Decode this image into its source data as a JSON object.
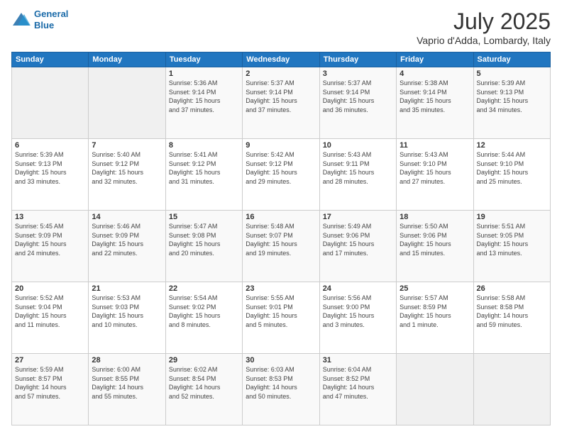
{
  "header": {
    "logo_line1": "General",
    "logo_line2": "Blue",
    "month_title": "July 2025",
    "location": "Vaprio d'Adda, Lombardy, Italy"
  },
  "days_of_week": [
    "Sunday",
    "Monday",
    "Tuesday",
    "Wednesday",
    "Thursday",
    "Friday",
    "Saturday"
  ],
  "weeks": [
    [
      {
        "day": "",
        "info": ""
      },
      {
        "day": "",
        "info": ""
      },
      {
        "day": "1",
        "info": "Sunrise: 5:36 AM\nSunset: 9:14 PM\nDaylight: 15 hours\nand 37 minutes."
      },
      {
        "day": "2",
        "info": "Sunrise: 5:37 AM\nSunset: 9:14 PM\nDaylight: 15 hours\nand 37 minutes."
      },
      {
        "day": "3",
        "info": "Sunrise: 5:37 AM\nSunset: 9:14 PM\nDaylight: 15 hours\nand 36 minutes."
      },
      {
        "day": "4",
        "info": "Sunrise: 5:38 AM\nSunset: 9:14 PM\nDaylight: 15 hours\nand 35 minutes."
      },
      {
        "day": "5",
        "info": "Sunrise: 5:39 AM\nSunset: 9:13 PM\nDaylight: 15 hours\nand 34 minutes."
      }
    ],
    [
      {
        "day": "6",
        "info": "Sunrise: 5:39 AM\nSunset: 9:13 PM\nDaylight: 15 hours\nand 33 minutes."
      },
      {
        "day": "7",
        "info": "Sunrise: 5:40 AM\nSunset: 9:12 PM\nDaylight: 15 hours\nand 32 minutes."
      },
      {
        "day": "8",
        "info": "Sunrise: 5:41 AM\nSunset: 9:12 PM\nDaylight: 15 hours\nand 31 minutes."
      },
      {
        "day": "9",
        "info": "Sunrise: 5:42 AM\nSunset: 9:12 PM\nDaylight: 15 hours\nand 29 minutes."
      },
      {
        "day": "10",
        "info": "Sunrise: 5:43 AM\nSunset: 9:11 PM\nDaylight: 15 hours\nand 28 minutes."
      },
      {
        "day": "11",
        "info": "Sunrise: 5:43 AM\nSunset: 9:10 PM\nDaylight: 15 hours\nand 27 minutes."
      },
      {
        "day": "12",
        "info": "Sunrise: 5:44 AM\nSunset: 9:10 PM\nDaylight: 15 hours\nand 25 minutes."
      }
    ],
    [
      {
        "day": "13",
        "info": "Sunrise: 5:45 AM\nSunset: 9:09 PM\nDaylight: 15 hours\nand 24 minutes."
      },
      {
        "day": "14",
        "info": "Sunrise: 5:46 AM\nSunset: 9:09 PM\nDaylight: 15 hours\nand 22 minutes."
      },
      {
        "day": "15",
        "info": "Sunrise: 5:47 AM\nSunset: 9:08 PM\nDaylight: 15 hours\nand 20 minutes."
      },
      {
        "day": "16",
        "info": "Sunrise: 5:48 AM\nSunset: 9:07 PM\nDaylight: 15 hours\nand 19 minutes."
      },
      {
        "day": "17",
        "info": "Sunrise: 5:49 AM\nSunset: 9:06 PM\nDaylight: 15 hours\nand 17 minutes."
      },
      {
        "day": "18",
        "info": "Sunrise: 5:50 AM\nSunset: 9:06 PM\nDaylight: 15 hours\nand 15 minutes."
      },
      {
        "day": "19",
        "info": "Sunrise: 5:51 AM\nSunset: 9:05 PM\nDaylight: 15 hours\nand 13 minutes."
      }
    ],
    [
      {
        "day": "20",
        "info": "Sunrise: 5:52 AM\nSunset: 9:04 PM\nDaylight: 15 hours\nand 11 minutes."
      },
      {
        "day": "21",
        "info": "Sunrise: 5:53 AM\nSunset: 9:03 PM\nDaylight: 15 hours\nand 10 minutes."
      },
      {
        "day": "22",
        "info": "Sunrise: 5:54 AM\nSunset: 9:02 PM\nDaylight: 15 hours\nand 8 minutes."
      },
      {
        "day": "23",
        "info": "Sunrise: 5:55 AM\nSunset: 9:01 PM\nDaylight: 15 hours\nand 5 minutes."
      },
      {
        "day": "24",
        "info": "Sunrise: 5:56 AM\nSunset: 9:00 PM\nDaylight: 15 hours\nand 3 minutes."
      },
      {
        "day": "25",
        "info": "Sunrise: 5:57 AM\nSunset: 8:59 PM\nDaylight: 15 hours\nand 1 minute."
      },
      {
        "day": "26",
        "info": "Sunrise: 5:58 AM\nSunset: 8:58 PM\nDaylight: 14 hours\nand 59 minutes."
      }
    ],
    [
      {
        "day": "27",
        "info": "Sunrise: 5:59 AM\nSunset: 8:57 PM\nDaylight: 14 hours\nand 57 minutes."
      },
      {
        "day": "28",
        "info": "Sunrise: 6:00 AM\nSunset: 8:55 PM\nDaylight: 14 hours\nand 55 minutes."
      },
      {
        "day": "29",
        "info": "Sunrise: 6:02 AM\nSunset: 8:54 PM\nDaylight: 14 hours\nand 52 minutes."
      },
      {
        "day": "30",
        "info": "Sunrise: 6:03 AM\nSunset: 8:53 PM\nDaylight: 14 hours\nand 50 minutes."
      },
      {
        "day": "31",
        "info": "Sunrise: 6:04 AM\nSunset: 8:52 PM\nDaylight: 14 hours\nand 47 minutes."
      },
      {
        "day": "",
        "info": ""
      },
      {
        "day": "",
        "info": ""
      }
    ]
  ]
}
